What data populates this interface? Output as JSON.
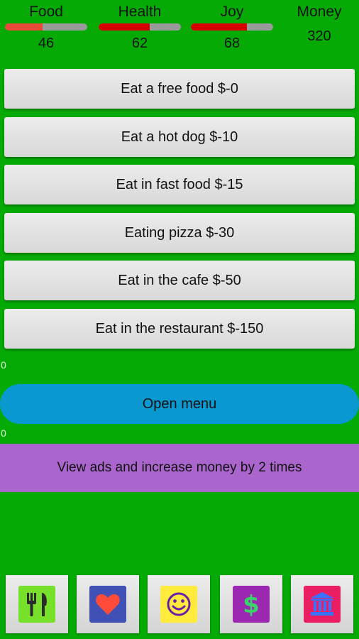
{
  "stats": [
    {
      "label": "Food",
      "value": "46",
      "level": 0.46,
      "color": "#e84a3a"
    },
    {
      "label": "Health",
      "value": "62",
      "level": 0.62,
      "color": "#d60000"
    },
    {
      "label": "Joy",
      "value": "68",
      "level": 0.68,
      "color": "#d60000"
    }
  ],
  "money": {
    "label": "Money",
    "value": "320"
  },
  "actions": [
    "Eat a free food $-0",
    "Eat a hot dog $-10",
    "Eat in fast food $-15",
    "Eating pizza $-30",
    "Eat in the cafe $-50",
    "Eat in the restaurant $-150"
  ],
  "counter_top": "0",
  "counter_bottom": "0",
  "open_menu": "Open menu",
  "ads_text": "View ads and increase money by 2 times",
  "tabs": [
    {
      "icon": "fork-knife-icon",
      "color": "#76e02a"
    },
    {
      "icon": "heart-icon",
      "color": "#3f51b5"
    },
    {
      "icon": "smiley-icon",
      "color": "#ffeb3b"
    },
    {
      "icon": "dollar-icon",
      "color": "#9c27b0"
    },
    {
      "icon": "bank-icon",
      "color": "#e91e63"
    }
  ]
}
